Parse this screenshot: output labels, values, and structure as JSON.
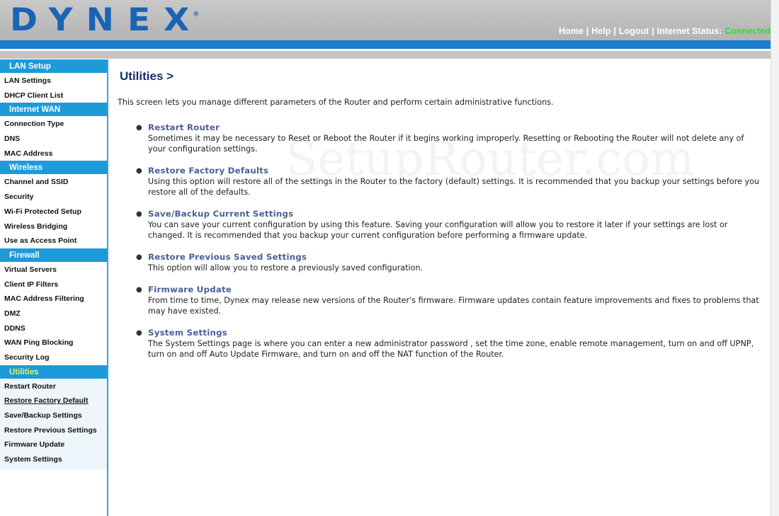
{
  "header": {
    "logo": "DYNEX",
    "logo_mark": "®",
    "nav": {
      "home": "Home",
      "help": "Help",
      "logout": "Logout",
      "status_label": "Internet Status:",
      "status_value": "Connected"
    }
  },
  "sidebar": {
    "lan_setup": {
      "heading": "LAN Setup",
      "items": [
        "LAN Settings",
        "DHCP Client List"
      ]
    },
    "internet_wan": {
      "heading": "Internet WAN",
      "items": [
        "Connection Type",
        "DNS",
        "MAC Address"
      ]
    },
    "wireless": {
      "heading": "Wireless",
      "items": [
        "Channel and SSID",
        "Security",
        "Wi-Fi Protected Setup",
        "Wireless Bridging",
        "Use as Access Point"
      ]
    },
    "firewall": {
      "heading": "Firewall",
      "items": [
        "Virtual Servers",
        "Client IP Filters",
        "MAC Address Filtering",
        "DMZ",
        "DDNS",
        "WAN Ping Blocking",
        "Security Log"
      ]
    },
    "utilities": {
      "heading": "Utilities",
      "items": [
        "Restart Router",
        "Restore Factory Default",
        "Save/Backup Settings",
        "Restore Previous Settings",
        "Firmware Update",
        "System Settings"
      ]
    }
  },
  "main": {
    "title": "Utilities >",
    "intro": "This screen lets you manage different parameters of the Router and perform certain administrative functions.",
    "watermark": "SetupRouter.com",
    "items": [
      {
        "title": "Restart Router",
        "desc": "Sometimes it may be necessary to Reset or Reboot the Router if it begins working improperly. Resetting or Rebooting the Router will not delete any of your configuration settings."
      },
      {
        "title": "Restore Factory Defaults",
        "desc": "Using this option will restore all of the settings in the Router to the factory (default) settings. It is recommended that you backup your settings before you restore all of the defaults."
      },
      {
        "title": "Save/Backup Current Settings",
        "desc": "You can save your current configuration by using this feature. Saving your configuration will allow you to restore it later if your settings are lost or changed. It is recommended that you backup your current configuration before performing a firmware update."
      },
      {
        "title": "Restore Previous Saved Settings",
        "desc": "This option will allow you to restore a previously saved configuration."
      },
      {
        "title": "Firmware Update",
        "desc": "From time to time, Dynex may release new versions of the Router's firmware. Firmware updates contain feature improvements and fixes to problems that may have existed."
      },
      {
        "title": "System Settings",
        "desc": "The System Settings page is where you can enter a new administrator password , set the time zone, enable remote management, turn on and off UPNP, turn on and off Auto Update Firmware, and turn on and off the NAT function of the Router."
      }
    ]
  },
  "colors": {
    "brand_blue": "#1b63b4",
    "section_blue": "#1d9ad8",
    "status_green": "#37d63c",
    "item_title": "#4a5f99"
  }
}
